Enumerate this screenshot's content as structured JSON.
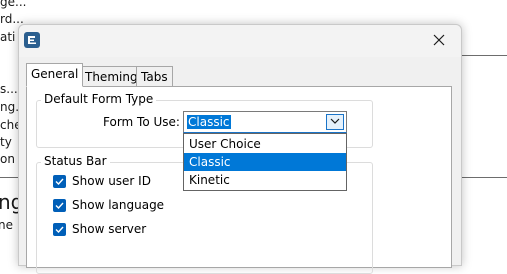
{
  "background_app": {
    "fragments": [
      "ge...",
      "rd...",
      "ati",
      "s...",
      "ng...",
      "che",
      "ty",
      "on",
      "ng",
      "ne"
    ]
  },
  "dialog": {
    "tabs": [
      {
        "label": "General",
        "active": true
      },
      {
        "label": "Theming",
        "active": false
      },
      {
        "label": "Tabs",
        "active": false
      }
    ],
    "form_type_group": {
      "title": "Default Form Type",
      "field_label": "Form To Use:",
      "selected_value": "Classic",
      "options": [
        "User Choice",
        "Classic",
        "Kinetic"
      ]
    },
    "status_bar_group": {
      "title": "Status Bar",
      "checkboxes": [
        {
          "label": "Show user ID",
          "checked": true
        },
        {
          "label": "Show language",
          "checked": true
        },
        {
          "label": "Show server",
          "checked": true
        }
      ]
    }
  },
  "colors": {
    "accent": "#0078d7",
    "checkbox": "#005fb8"
  }
}
